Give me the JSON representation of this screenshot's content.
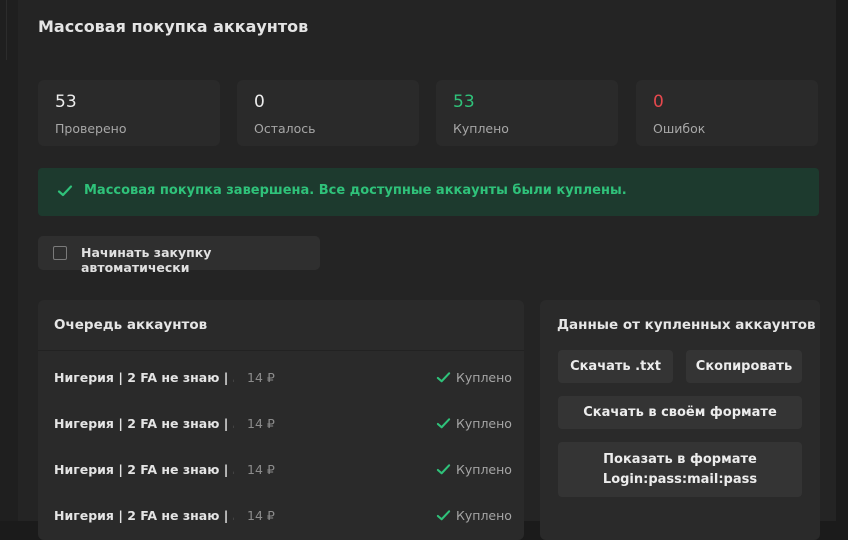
{
  "title": "Массовая покупка аккаунтов",
  "stats": [
    {
      "value": "53",
      "label": "Проверено"
    },
    {
      "value": "0",
      "label": "Осталось"
    },
    {
      "value": "53",
      "label": "Куплено"
    },
    {
      "value": "0",
      "label": "Ошибок"
    }
  ],
  "colors": {
    "success": "#2fc27a",
    "error": "#e5484d",
    "success_bg": "#1d3a2e"
  },
  "alert": {
    "icon": "check-icon",
    "message": "Массовая покупка завершена. Все доступные аккаунты были куплены."
  },
  "auto_buy": {
    "label": "Начинать закупку автоматически",
    "checked": false
  },
  "queue": {
    "title": "Очередь аккаунтов",
    "rows": [
      {
        "name": "Нигерия | 2 FA не знаю | ...",
        "price": "14 ₽",
        "status": "Куплено"
      },
      {
        "name": "Нигерия | 2 FA не знаю | ...",
        "price": "14 ₽",
        "status": "Куплено"
      },
      {
        "name": "Нигерия | 2 FA не знаю | ...",
        "price": "14 ₽",
        "status": "Куплено"
      },
      {
        "name": "Нигерия | 2 FA не знаю | ...",
        "price": "14 ₽",
        "status": "Куплено"
      }
    ]
  },
  "purchased": {
    "title": "Данные от купленных аккаунтов",
    "download_txt": "Скачать .txt",
    "copy": "Скопировать",
    "download_custom": "Скачать в своём формате",
    "show_format_line1": "Показать в формате",
    "show_format_line2": "Login:pass:mail:pass"
  }
}
